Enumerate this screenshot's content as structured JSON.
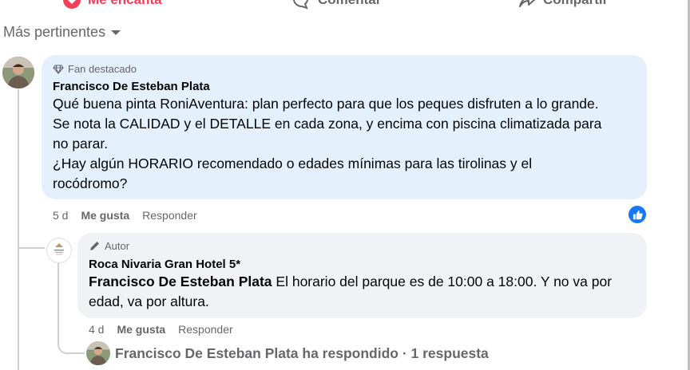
{
  "actions": {
    "love": "Me encanta",
    "comment": "Comentar",
    "share": "Compartir"
  },
  "sort": {
    "label": "Más pertinentes"
  },
  "comment": {
    "badge": "Fan destacado",
    "author": "Francisco De Esteban Plata",
    "lines": [
      "Qué buena pinta RoniAventura: plan perfecto para que los peques disfruten a lo grande.",
      "Se nota la CALIDAD y el DETALLE en cada zona, y encima con piscina climatizada para",
      "no parar.",
      "¿Hay algún HORARIO recomendado o edades mínimas para las tirolinas y el",
      "rocódromo?"
    ],
    "time": "5 d",
    "like": "Me gusta",
    "reply": "Responder"
  },
  "reply": {
    "badge": "Autor",
    "author": "Roca Nivaria Gran Hotel 5*",
    "mention": "Francisco De Esteban Plata",
    "text_first": " El horario del parque es de 10:00 a 18:00. Y no va por",
    "text_second": "edad, va por altura.",
    "time": "4 d",
    "like": "Me gusta",
    "reply": "Responder"
  },
  "more_replies": {
    "text": "Francisco De Esteban Plata ha respondido · 1 respuesta"
  },
  "colors": {
    "comment_bubble": "#e4f0fb",
    "reply_bubble": "#f0f2f5",
    "like_blue": "#1877f2",
    "love_red": "#f33e58",
    "muted": "#65676b"
  }
}
